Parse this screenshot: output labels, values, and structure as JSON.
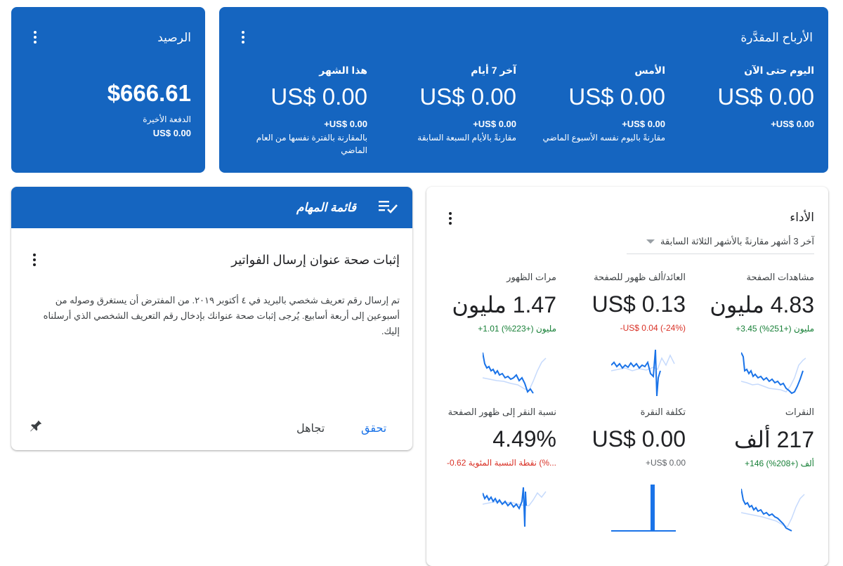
{
  "earnings": {
    "title": "الأرباح المقدَّرة",
    "columns": [
      {
        "label": "اليوم حتى الآن",
        "value": "US$ 0.00",
        "change": "+US$ 0.00",
        "compare": ""
      },
      {
        "label": "الأمس",
        "value": "US$ 0.00",
        "change": "+US$ 0.00",
        "compare": "مقارنةً باليوم نفسه الأسبوع الماضي"
      },
      {
        "label": "آخر 7 أيام",
        "value": "US$ 0.00",
        "change": "+US$ 0.00",
        "compare": "مقارنةً بالأيام السبعة السابقة"
      },
      {
        "label": "هذا الشهر",
        "value": "US$ 0.00",
        "change": "+US$ 0.00",
        "compare": "بالمقارنة بالفترة نفسها من العام الماضي"
      }
    ]
  },
  "balance": {
    "title": "الرصيد",
    "amount": "$666.61",
    "last_payment_label": "الدفعة الأخيرة",
    "last_payment_value": "US$ 0.00"
  },
  "tasks": {
    "header": "قائمة المهام",
    "item_title": "إثبات صحة عنوان إرسال الفواتير",
    "item_body": "تم إرسال رقم تعريف شخصي بالبريد في ٤ أكتوبر ٢٠١٩. من المفترض أن يستغرق وصوله من أسبوعين إلى أربعة أسابيع. يُرجى إثبات صحة عنوانك بإدخال رقم التعريف الشخصي الذي أرسلناه إليك.",
    "verify_label": "تحقق",
    "ignore_label": "تجاهل"
  },
  "performance": {
    "title": "الأداء",
    "period_num": "3",
    "period_text": "آخر 3 أشهر مقارنةً بالأشهر الثلاثة السابقة",
    "metrics": [
      {
        "label": "مشاهدات الصفحة",
        "value": "4.83 مليون",
        "change": "+3.45 مليون (+251%)",
        "trend": "up"
      },
      {
        "label": "العائد/ألف ظهور للصفحة",
        "value": "US$ 0.13",
        "change": "-US$ 0.04 (-24%)",
        "trend": "down"
      },
      {
        "label": "مرات الظهور",
        "value": "1.47 مليون",
        "change": "+1.01 مليون (+223%)",
        "trend": "up"
      },
      {
        "label": "النقرات",
        "value": "217 ألف",
        "change": "+146 ألف (+208%)",
        "trend": "up"
      },
      {
        "label": "تكلفة النقرة",
        "value": "US$ 0.00",
        "change": "+US$ 0.00",
        "trend": "neutral"
      },
      {
        "label": "نسبة النقر إلى ظهور الصفحة",
        "value": "4.49%",
        "change": "-0.62 نقطة النسبة المئوية (%...",
        "trend": "down"
      }
    ]
  },
  "colors": {
    "brand_blue": "#1565c0",
    "spark_current": "#1a73e8",
    "spark_previous": "#c6dafc",
    "positive": "#188038",
    "negative": "#d93025"
  },
  "icons": {
    "menu": "more-vert-icon",
    "tasks": "playlist-check-icon",
    "pin": "pin-icon",
    "dropdown": "arrow-drop-down-icon"
  }
}
